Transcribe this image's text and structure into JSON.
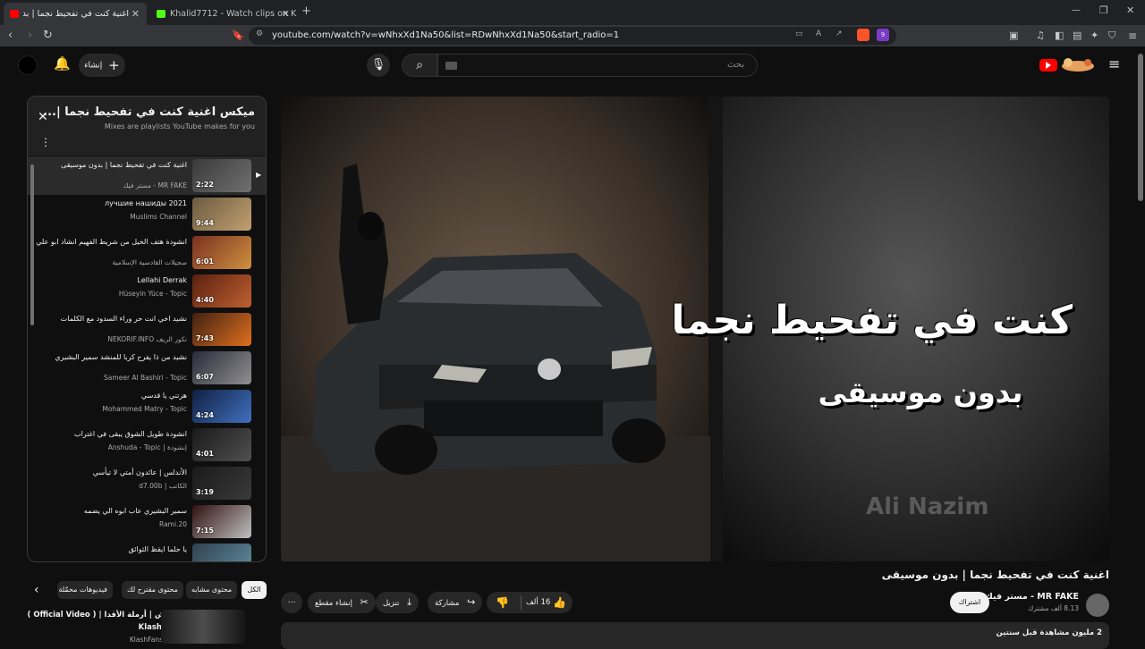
{
  "browser": {
    "tabs": [
      {
        "title": "اغنية كنت في تفحيط نجما | بدون"
      },
      {
        "title": "Khalid7712 - Watch clips on Kick"
      }
    ],
    "new_tab": "+",
    "url": "youtube.com/watch?v=wNhxXd1Na50&list=RDwNhxXd1Na50&start_radio=1",
    "brave_badge": "9"
  },
  "header": {
    "search_placeholder": "بحث",
    "create_label": "إنشاء"
  },
  "playlist": {
    "title": "ميكس اغنية كنت في تفحيط نجما |...",
    "subtitle": "Mixes are playlists YouTube makes for you",
    "items": [
      {
        "title": "اغنية كنت في تفحيط نجما | بدون موسيقى",
        "channel": "مستر فيك - MR FAKE",
        "duration": "2:22",
        "current": true
      },
      {
        "title": "лучшие нашиды 2021",
        "channel": "Muslims Channel",
        "duration": "9:44"
      },
      {
        "title": "انشودة هتف الخيل من شريط الفهيم انشاد ابو علي",
        "channel": "سجيلات القادسية الإسلامية",
        "duration": "6:01"
      },
      {
        "title": "Lellahi Derrak",
        "channel": "Hüseyin Yüce - Topic",
        "duration": "4:40"
      },
      {
        "title": "نشيد اخي انت حر وراء السدود مع الكلمات",
        "channel": "NEKORIF.INFO نكور الريف",
        "duration": "7:43"
      },
      {
        "title": "نشيد من ذا يفرح كربا للمنشد سمير البشيري",
        "channel": "Sameer Al Bashiri - Topic",
        "duration": "6:07"
      },
      {
        "title": "هزتني يا قدسي",
        "channel": "Mohammed Matry - Topic",
        "duration": "4:24"
      },
      {
        "title": "انشودة طويل الشوق يبقى في اغتراب",
        "channel": "Anshuda - Topic | إنشودة",
        "duration": "4:01"
      },
      {
        "title": "الأندلس | عائدون أمتي لا تيأسي",
        "channel": "d7.00b | الكاتب",
        "duration": "3:19"
      },
      {
        "title": "سمير البشيري عاب ابوه الي يضمه",
        "channel": "Rami.20",
        "duration": "7:15"
      },
      {
        "title": "يا حلما ايقظ الثوائق",
        "channel": "",
        "duration": ""
      }
    ]
  },
  "video": {
    "overlay_line1": "كنت في تفحيط نجما",
    "overlay_line2": "بدون موسيقى",
    "watermark": "Ali Nazim",
    "title": "اغنية كنت في تفحيط نجما | بدون موسيقى",
    "channel": "مستر فيك - MR FAKE",
    "subscribers": "8.13 ألف مشترك",
    "subscribe_label": "اشتراك",
    "likes": "16 ألف",
    "share_label": "مشاركة",
    "download_label": "تنزيل",
    "clip_label": "إنشاء مقطع",
    "views": "2 مليون مشاهدة  قبل سنتين"
  },
  "chips": [
    "الكل",
    "محتوى مشابه",
    "محتوى مقترح لك",
    "فيديوهات محمّلة مؤخرًا"
  ],
  "next_video": {
    "title": "كلاش | أرملة الأقدا | ( Official Video )",
    "channel": "Klash",
    "sub": "KlashFans"
  }
}
